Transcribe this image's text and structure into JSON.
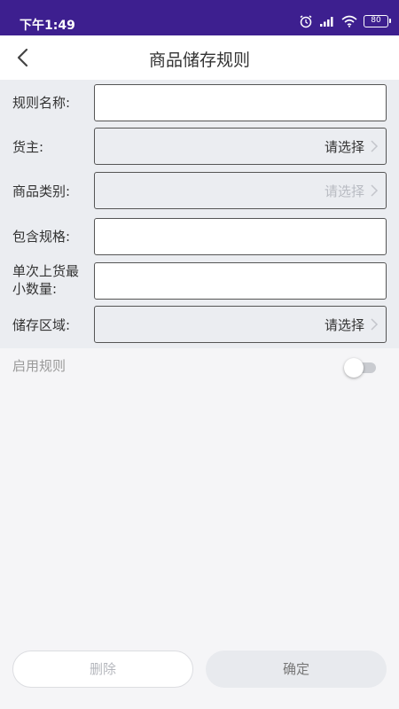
{
  "status_bar": {
    "time": "下午1:49",
    "battery": "80",
    "icons": [
      "alarm-icon",
      "signal-icon",
      "wifi-icon",
      "battery-icon"
    ]
  },
  "nav": {
    "title": "商品储存规则",
    "back_icon": "chevron-left-icon"
  },
  "form": {
    "rule_name": {
      "label": "规则名称:",
      "value": ""
    },
    "owner": {
      "label": "货主:",
      "value": "请选择"
    },
    "category": {
      "label": "商品类别:",
      "value": "请选择"
    },
    "spec": {
      "label": "包含规格:",
      "value": ""
    },
    "min_qty": {
      "label_line1": "单次上货最",
      "label_line2": "小数量:",
      "value": ""
    },
    "storage_area": {
      "label": "储存区域:",
      "value": "请选择"
    }
  },
  "enable_rule": {
    "label": "启用规则",
    "enabled": false
  },
  "buttons": {
    "delete": "删除",
    "confirm": "确定"
  },
  "colors": {
    "status_bar": "#3d1f8f",
    "form_bg": "#ebedf1",
    "page_bg": "#f5f5f7"
  }
}
